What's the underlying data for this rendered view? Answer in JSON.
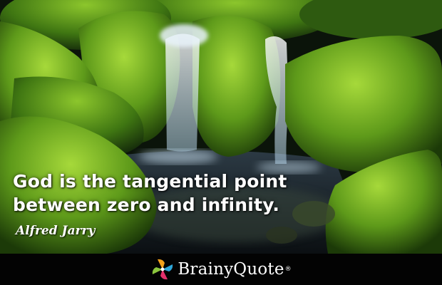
{
  "quote": {
    "lines": [
      "God is the tangential point",
      "between zero and infinity."
    ],
    "author": "Alfred Jarry"
  },
  "brand": {
    "name": "BrainyQuote",
    "registered": "®",
    "icon": "brainyquote-pinwheel-icon"
  },
  "scene": {
    "subject": "mossy-rocks-waterfall-photo",
    "colors": {
      "moss": "#5e9a1a",
      "moss_light": "#a6d93a",
      "water": "#dfeef8",
      "shadow": "#0b140a"
    }
  }
}
